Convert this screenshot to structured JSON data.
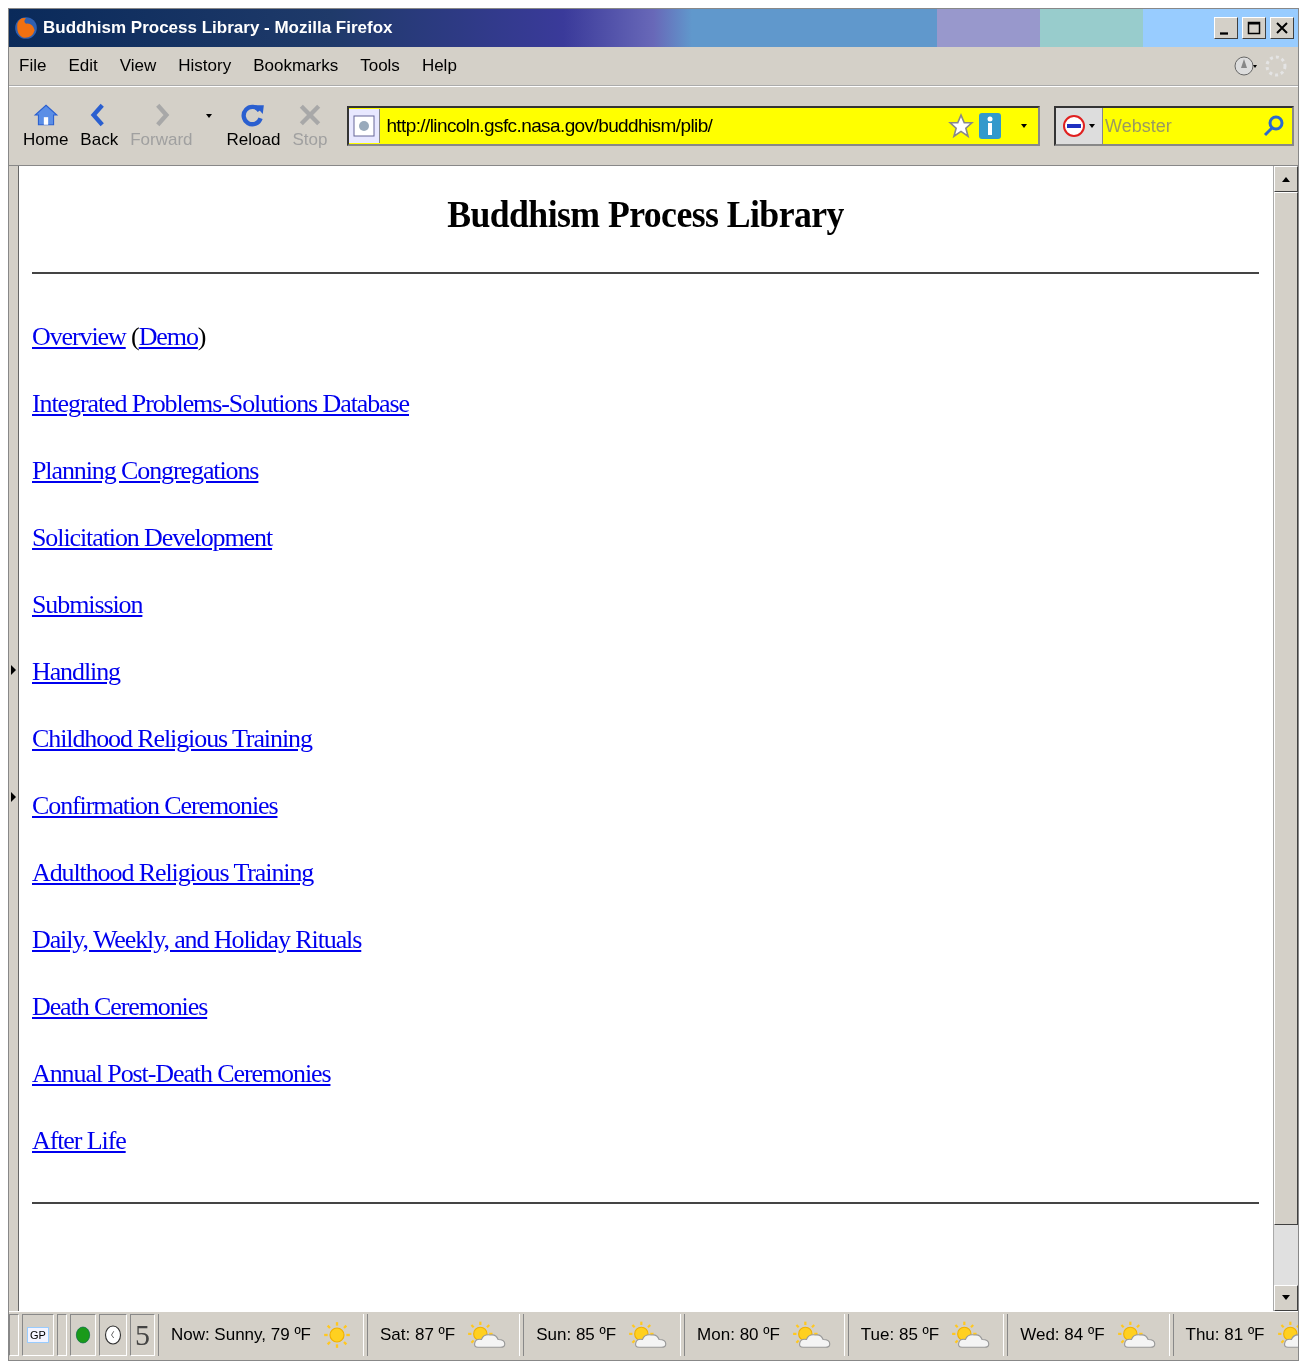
{
  "window": {
    "title": "Buddhism Process Library - Mozilla Firefox"
  },
  "menu": [
    "File",
    "Edit",
    "View",
    "History",
    "Bookmarks",
    "Tools",
    "Help"
  ],
  "toolbar": [
    {
      "kind": "home",
      "label": "Home",
      "disabled": false
    },
    {
      "kind": "back",
      "label": "Back",
      "disabled": false
    },
    {
      "kind": "forward",
      "label": "Forward",
      "disabled": true
    },
    {
      "kind": "reload",
      "label": "Reload",
      "disabled": false
    },
    {
      "kind": "stop",
      "label": "Stop",
      "disabled": true
    }
  ],
  "address": {
    "value": "http://lincoln.gsfc.nasa.gov/buddhism/plib/"
  },
  "search": {
    "placeholder": "Webster"
  },
  "page": {
    "heading": "Buddhism Process Library",
    "lines": [
      {
        "parts": [
          {
            "text": "Overview",
            "link": true
          },
          {
            "text": " (",
            "link": false
          },
          {
            "text": "Demo",
            "link": true
          },
          {
            "text": ")",
            "link": false
          }
        ]
      },
      {
        "parts": [
          {
            "text": "Integrated Problems-Solutions Database",
            "link": true
          }
        ]
      },
      {
        "parts": [
          {
            "text": "Planning Congregations",
            "link": true
          }
        ]
      },
      {
        "parts": [
          {
            "text": "Solicitation Development",
            "link": true
          }
        ]
      },
      {
        "parts": [
          {
            "text": "Submission",
            "link": true
          }
        ]
      },
      {
        "parts": [
          {
            "text": "Handling",
            "link": true
          }
        ]
      },
      {
        "parts": [
          {
            "text": "Childhood Religious Training",
            "link": true
          }
        ]
      },
      {
        "parts": [
          {
            "text": "Confirmation Ceremonies",
            "link": true
          }
        ]
      },
      {
        "parts": [
          {
            "text": "Adulthood Religious Training",
            "link": true
          }
        ]
      },
      {
        "parts": [
          {
            "text": "Daily, Weekly, and Holiday Rituals",
            "link": true
          }
        ]
      },
      {
        "parts": [
          {
            "text": "Death Ceremonies",
            "link": true
          }
        ]
      },
      {
        "parts": [
          {
            "text": "Annual Post-Death Ceremonies",
            "link": true
          }
        ]
      },
      {
        "parts": [
          {
            "text": "After Life",
            "link": true
          }
        ]
      }
    ]
  },
  "status_bar": {
    "badge": "GP",
    "counter": "5",
    "weather": [
      {
        "label": "Now: Sunny, 79 ºF",
        "kind": "sunny"
      },
      {
        "label": "Sat: 87 ºF",
        "kind": "partly_cloudy"
      },
      {
        "label": "Sun: 85 ºF",
        "kind": "partly_cloudy"
      },
      {
        "label": "Mon: 80 ºF",
        "kind": "partly_cloudy"
      },
      {
        "label": "Tue: 85 ºF",
        "kind": "partly_cloudy"
      },
      {
        "label": "Wed: 84 ºF",
        "kind": "partly_cloudy"
      },
      {
        "label": "Thu: 81 ºF",
        "kind": "partly_cloudy"
      }
    ]
  }
}
